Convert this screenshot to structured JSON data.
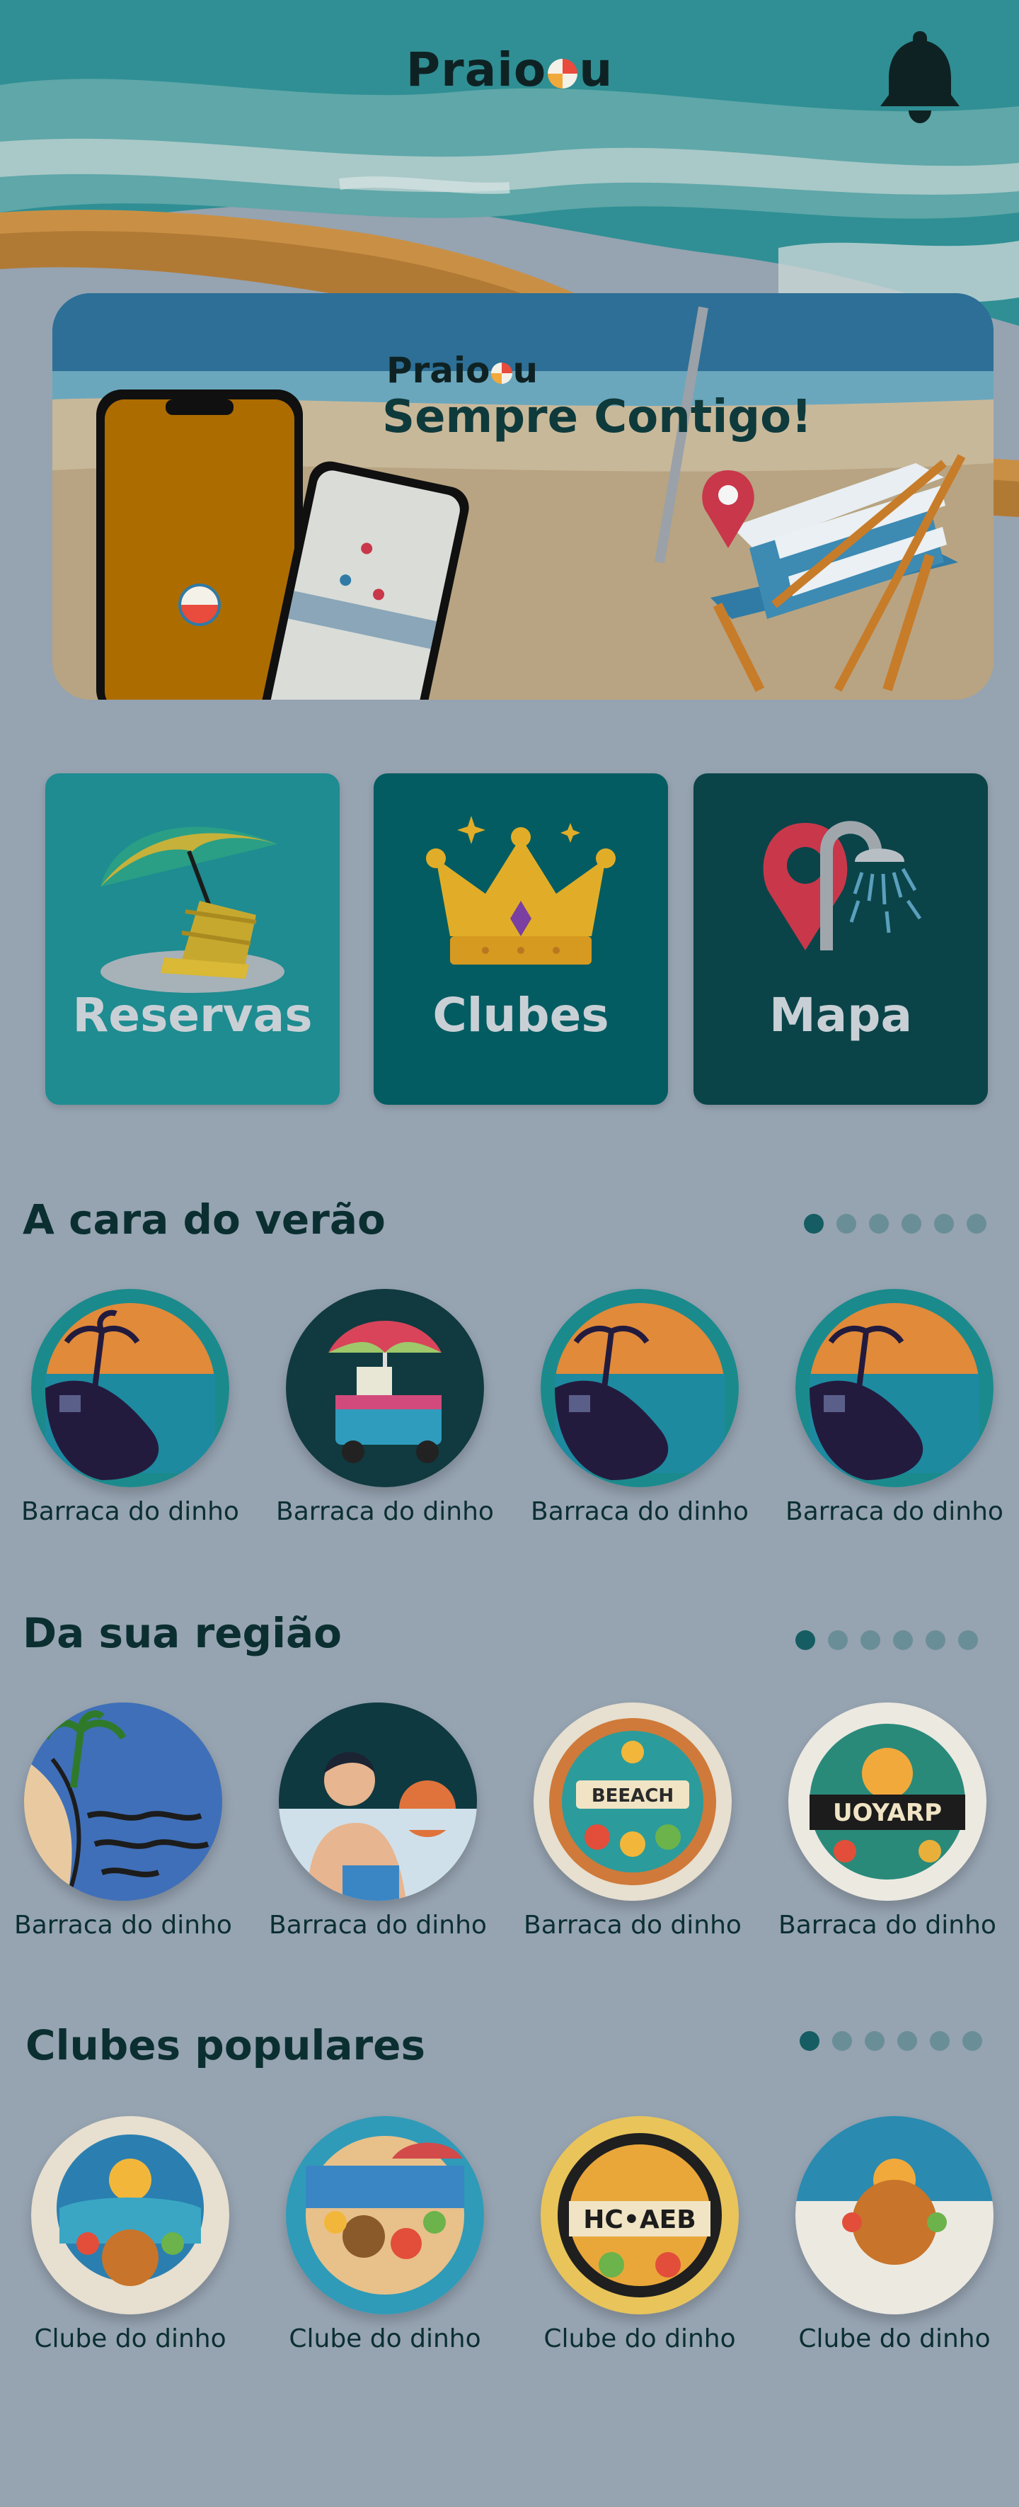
{
  "header": {
    "logo": "Praio",
    "logo_end": "u",
    "notification_icon": "bell-icon"
  },
  "banner": {
    "logo": "Praio",
    "logo_end": "u",
    "tagline": "Sempre Contigo!"
  },
  "categories": [
    {
      "label": "Reservas",
      "icon": "beach-chair-umbrella-icon",
      "color": "#1e8c91"
    },
    {
      "label": "Clubes",
      "icon": "crown-icon",
      "color": "#035c62"
    },
    {
      "label": "Mapa",
      "icon": "map-pin-shower-icon",
      "color": "#0a4449"
    }
  ],
  "sections": [
    {
      "title": "A cara do verão",
      "dots": 6,
      "active_dot": 0,
      "items": [
        {
          "label": "Barraca do dinho",
          "image": "sunset-island"
        },
        {
          "label": "Barraca do dinho",
          "image": "beach-cart"
        },
        {
          "label": "Barraca do dinho",
          "image": "sunset-island"
        },
        {
          "label": "Barraca do dinho",
          "image": "sunset-island"
        }
      ]
    },
    {
      "title": "Da sua região",
      "dots": 6,
      "active_dot": 0,
      "items": [
        {
          "label": "Barraca do dinho",
          "image": "palm-beach"
        },
        {
          "label": "Barraca do dinho",
          "image": "man-sunset"
        },
        {
          "label": "Barraca do dinho",
          "image": "beach-food-badge"
        },
        {
          "label": "Barraca do dinho",
          "image": "prayou-badge"
        }
      ]
    },
    {
      "title": "Clubes populares",
      "dots": 6,
      "active_dot": 0,
      "items": [
        {
          "label": "Clube do dinho",
          "image": "restaurant-badge"
        },
        {
          "label": "Clube do dinho",
          "image": "beach-table"
        },
        {
          "label": "Clube do dinho",
          "image": "beach-badge"
        },
        {
          "label": "Clube do dinho",
          "image": "restaurant-seal"
        }
      ]
    }
  ]
}
